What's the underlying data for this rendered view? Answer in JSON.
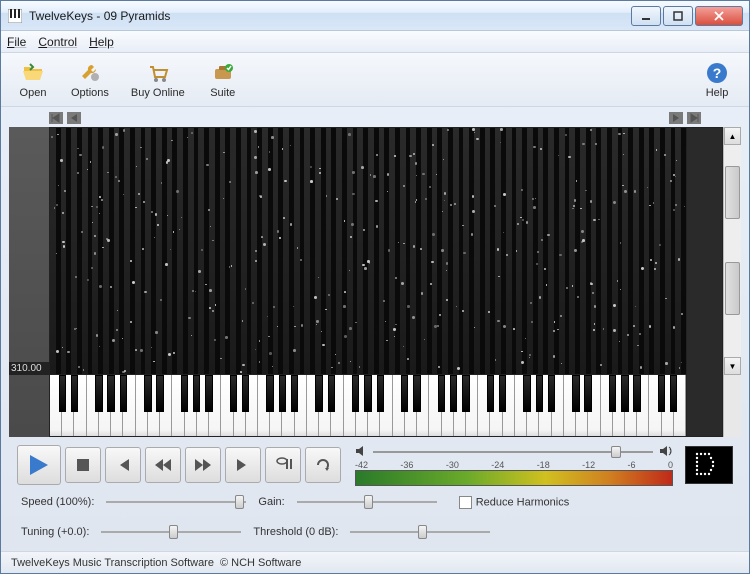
{
  "window": {
    "title": "TwelveKeys - 09 Pyramids"
  },
  "menu": {
    "file": "File",
    "control": "Control",
    "help": "Help"
  },
  "toolbar": {
    "open": "Open",
    "options": "Options",
    "buy": "Buy Online",
    "suite": "Suite",
    "help": "Help"
  },
  "timeline": {
    "current_time": "310.00"
  },
  "meter": {
    "ticks": [
      "-42",
      "-36",
      "-30",
      "-24",
      "-18",
      "-12",
      "-6",
      "0"
    ]
  },
  "note_display": "D",
  "controls": {
    "speed_label": "Speed (100%):",
    "tuning_label": "Tuning (+0.0):",
    "gain_label": "Gain:",
    "threshold_label": "Threshold (0 dB):",
    "reduce_harmonics": "Reduce Harmonics"
  },
  "status": {
    "product": "TwelveKeys Music Transcription Software",
    "company": "© NCH Software"
  }
}
